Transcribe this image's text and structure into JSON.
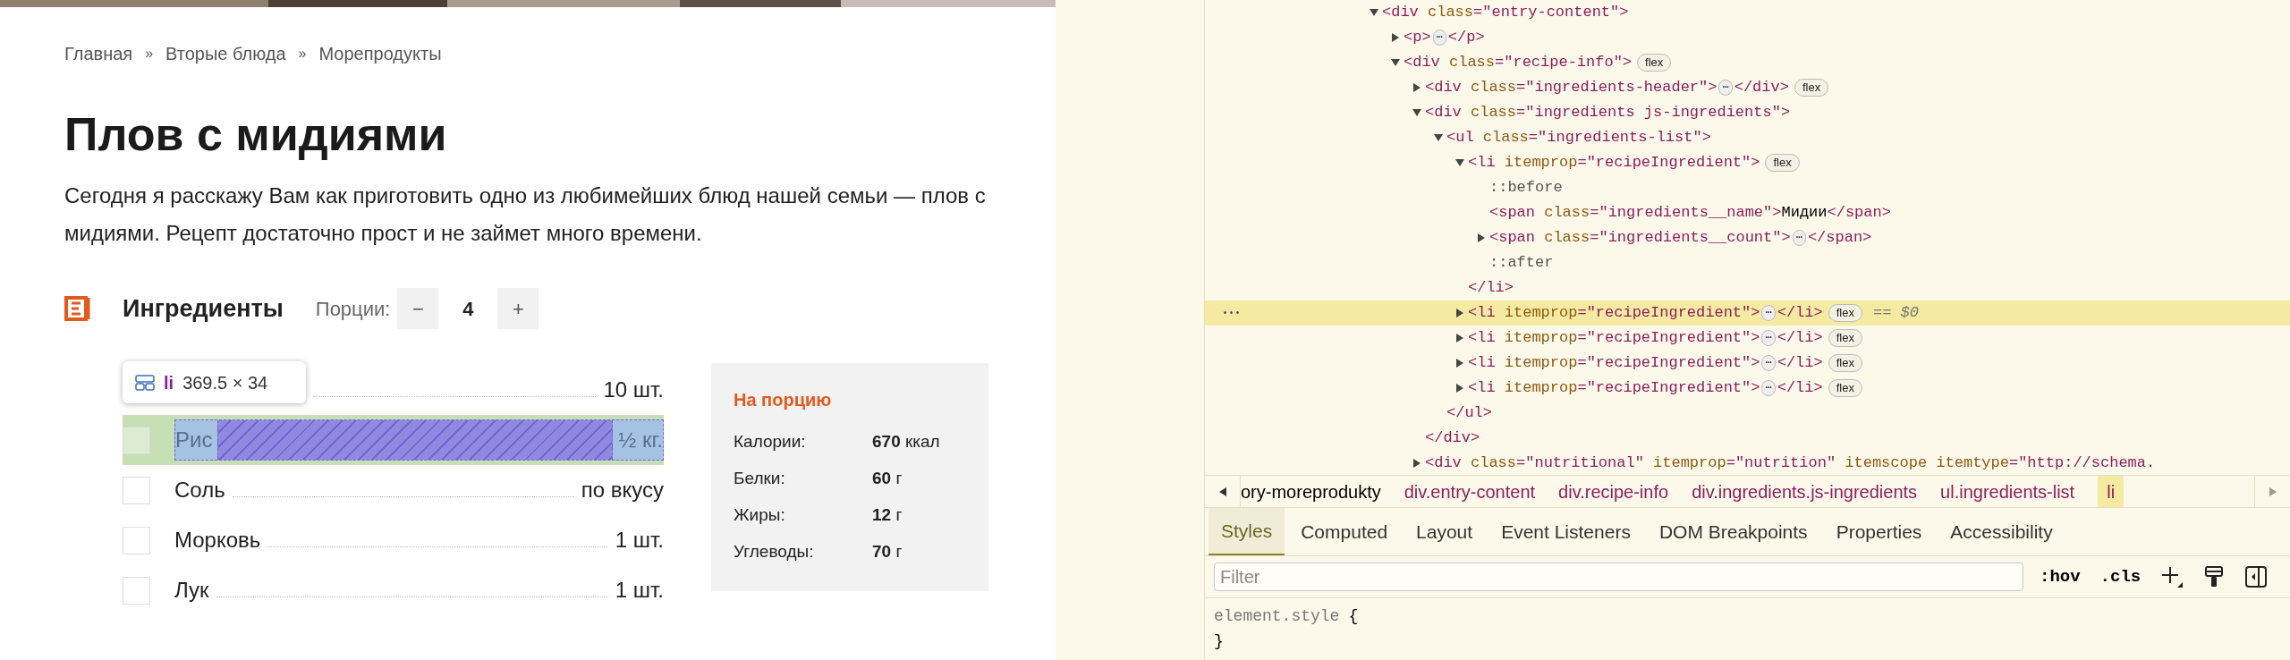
{
  "page": {
    "breadcrumb": [
      {
        "kind": "link",
        "text": "Главная"
      },
      {
        "kind": "separator",
        "text": "»"
      },
      {
        "kind": "link",
        "text": "Вторые блюда"
      },
      {
        "kind": "separator",
        "text": "»"
      },
      {
        "kind": "link",
        "text": "Морепродукты"
      }
    ],
    "title": "Плов с мидиями",
    "intro": "Сегодня я расскажу Вам как приготовить одно из любимейших блюд нашей семьи — плов с мидиями. Рецепт достаточно прост и не займет много времени.",
    "ingredients_header": {
      "title": "Ингредиенты",
      "servings_label": "Порции:",
      "minus": "−",
      "servings": "4",
      "plus": "+"
    },
    "inspector_tooltip": {
      "tag": "li",
      "size": "369.5 × 34"
    },
    "ingredients": [
      {
        "amount": "10 шт.",
        "highlighted": false
      },
      {
        "name": "Рис",
        "amount": "½ кг.",
        "checked": false,
        "highlighted": true
      },
      {
        "name": "Соль",
        "amount": "по вкусу",
        "checked": false,
        "highlighted": false
      },
      {
        "name": "Морковь",
        "amount": "1 шт.",
        "checked": false,
        "highlighted": false
      },
      {
        "name": "Лук",
        "amount": "1 шт.",
        "checked": false,
        "highlighted": false
      }
    ],
    "nutrition": {
      "title": "На порцию",
      "rows": [
        {
          "label": "Калории:",
          "value": "**670** ккал"
        },
        {
          "label": "Белки:",
          "value": "**60** г"
        },
        {
          "label": "Жиры:",
          "value": "**12** г"
        },
        {
          "label": "Углеводы:",
          "value": "**70** г"
        }
      ]
    }
  },
  "devtools": {
    "dom_tree": [
      {
        "selected": false,
        "expanded": true,
        "tokens": [
          {
            "kind": "tag",
            "text": "<div"
          },
          {
            "kind": "attr",
            "text": " class"
          },
          {
            "kind": "tag",
            "text": "=\"entry-content\">"
          }
        ],
        "children": [
          {
            "selected": false,
            "expanded": false,
            "tokens": [
              {
                "kind": "tag",
                "text": "<p>"
              },
              {
                "kind": "more",
                "text": "⋯"
              },
              {
                "kind": "tag",
                "text": "</p>"
              }
            ]
          },
          {
            "selected": false,
            "expanded": true,
            "badge": "flex",
            "tokens": [
              {
                "kind": "tag",
                "text": "<div"
              },
              {
                "kind": "attr",
                "text": " class"
              },
              {
                "kind": "tag",
                "text": "=\"recipe-info\">"
              }
            ],
            "children": [
              {
                "selected": false,
                "expanded": false,
                "badge": "flex",
                "tokens": [
                  {
                    "kind": "tag",
                    "text": "<div"
                  },
                  {
                    "kind": "attr",
                    "text": " class"
                  },
                  {
                    "kind": "tag",
                    "text": "=\"ingredients-header\">"
                  },
                  {
                    "kind": "more",
                    "text": "⋯"
                  },
                  {
                    "kind": "tag",
                    "text": "</div>"
                  }
                ]
              },
              {
                "selected": false,
                "expanded": true,
                "tokens": [
                  {
                    "kind": "tag",
                    "text": "<div"
                  },
                  {
                    "kind": "attr",
                    "text": " class"
                  },
                  {
                    "kind": "tag",
                    "text": "=\"ingredients js-ingredients\">"
                  }
                ],
                "close": [
                  {
                    "kind": "tag",
                    "text": "</div>"
                  }
                ],
                "children": [
                  {
                    "selected": false,
                    "expanded": true,
                    "tokens": [
                      {
                        "kind": "tag",
                        "text": "<ul"
                      },
                      {
                        "kind": "attr",
                        "text": " class"
                      },
                      {
                        "kind": "tag",
                        "text": "=\"ingredients-list\">"
                      }
                    ],
                    "close": [
                      {
                        "kind": "tag",
                        "text": "</ul>"
                      }
                    ],
                    "children": [
                      {
                        "selected": false,
                        "expanded": true,
                        "badge": "flex",
                        "tokens": [
                          {
                            "kind": "tag",
                            "text": "<li"
                          },
                          {
                            "kind": "attr",
                            "text": " itemprop"
                          },
                          {
                            "kind": "tag",
                            "text": "=\"recipeIngredient\">"
                          }
                        ],
                        "close": [
                          {
                            "kind": "tag",
                            "text": "</li>"
                          }
                        ],
                        "children": [
                          {
                            "selected": false,
                            "tokens": [
                              {
                                "kind": "pseudo",
                                "text": "::before"
                              }
                            ]
                          },
                          {
                            "selected": false,
                            "tokens": [
                              {
                                "kind": "tag",
                                "text": "<span"
                              },
                              {
                                "kind": "attr",
                                "text": " class"
                              },
                              {
                                "kind": "tag",
                                "text": "=\"ingredients__name\">"
                              },
                              {
                                "kind": "text",
                                "text": "Мидии"
                              },
                              {
                                "kind": "tag",
                                "text": "</span>"
                              }
                            ]
                          },
                          {
                            "selected": false,
                            "expanded": false,
                            "tokens": [
                              {
                                "kind": "tag",
                                "text": "<span"
                              },
                              {
                                "kind": "attr",
                                "text": " class"
                              },
                              {
                                "kind": "tag",
                                "text": "=\"ingredients__count\">"
                              },
                              {
                                "kind": "more",
                                "text": "⋯"
                              },
                              {
                                "kind": "tag",
                                "text": "</span>"
                              }
                            ]
                          },
                          {
                            "selected": false,
                            "tokens": [
                              {
                                "kind": "pseudo",
                                "text": "::after"
                              }
                            ]
                          }
                        ]
                      },
                      {
                        "selected": true,
                        "expanded": false,
                        "badge": "flex",
                        "gutter": "•••",
                        "marker": "== $0",
                        "tokens": [
                          {
                            "kind": "tag",
                            "text": "<li"
                          },
                          {
                            "kind": "attr",
                            "text": " itemprop"
                          },
                          {
                            "kind": "tag",
                            "text": "=\"recipeIngredient\">"
                          },
                          {
                            "kind": "more",
                            "text": "⋯"
                          },
                          {
                            "kind": "tag",
                            "text": "</li>"
                          }
                        ]
                      },
                      {
                        "selected": false,
                        "expanded": false,
                        "badge": "flex",
                        "tokens": [
                          {
                            "kind": "tag",
                            "text": "<li"
                          },
                          {
                            "kind": "attr",
                            "text": " itemprop"
                          },
                          {
                            "kind": "tag",
                            "text": "=\"recipeIngredient\">"
                          },
                          {
                            "kind": "more",
                            "text": "⋯"
                          },
                          {
                            "kind": "tag",
                            "text": "</li>"
                          }
                        ]
                      },
                      {
                        "selected": false,
                        "expanded": false,
                        "badge": "flex",
                        "tokens": [
                          {
                            "kind": "tag",
                            "text": "<li"
                          },
                          {
                            "kind": "attr",
                            "text": " itemprop"
                          },
                          {
                            "kind": "tag",
                            "text": "=\"recipeIngredient\">"
                          },
                          {
                            "kind": "more",
                            "text": "⋯"
                          },
                          {
                            "kind": "tag",
                            "text": "</li>"
                          }
                        ]
                      },
                      {
                        "selected": false,
                        "expanded": false,
                        "badge": "flex",
                        "tokens": [
                          {
                            "kind": "tag",
                            "text": "<li"
                          },
                          {
                            "kind": "attr",
                            "text": " itemprop"
                          },
                          {
                            "kind": "tag",
                            "text": "=\"recipeIngredient\">"
                          },
                          {
                            "kind": "more",
                            "text": "⋯"
                          },
                          {
                            "kind": "tag",
                            "text": "</li>"
                          }
                        ]
                      }
                    ]
                  }
                ]
              },
              {
                "selected": false,
                "expanded": false,
                "tokens": [
                  {
                    "kind": "tag",
                    "text": "<div"
                  },
                  {
                    "kind": "attr",
                    "text": " class"
                  },
                  {
                    "kind": "tag",
                    "text": "=\"nutritional\""
                  },
                  {
                    "kind": "attr",
                    "text": " itemprop"
                  },
                  {
                    "kind": "tag",
                    "text": "=\"nutrition\""
                  },
                  {
                    "kind": "attr",
                    "text": " itemscope"
                  },
                  {
                    "kind": "attr",
                    "text": " itemtype"
                  },
                  {
                    "kind": "tag",
                    "text": "=\"http://schema."
                  }
                ]
              }
            ]
          }
        ]
      }
    ],
    "breadcrumb": [
      {
        "kind": "plain",
        "text": "ory-moreprodukty",
        "selected": false
      },
      {
        "kind": "element",
        "text": "div.entry-content",
        "selected": false
      },
      {
        "kind": "element",
        "text": "div.recipe-info",
        "selected": false
      },
      {
        "kind": "element",
        "text": "div.ingredients.js-ingredients",
        "selected": false
      },
      {
        "kind": "element",
        "text": "ul.ingredients-list",
        "selected": false
      },
      {
        "kind": "element",
        "text": "li",
        "selected": true
      }
    ],
    "tabs": [
      {
        "label": "Styles",
        "selected": true
      },
      {
        "label": "Computed",
        "selected": false
      },
      {
        "label": "Layout",
        "selected": false
      },
      {
        "label": "Event Listeners",
        "selected": false
      },
      {
        "label": "DOM Breakpoints",
        "selected": false
      },
      {
        "label": "Properties",
        "selected": false
      },
      {
        "label": "Accessibility",
        "selected": false
      }
    ],
    "filter": {
      "placeholder": "Filter"
    },
    "filter_buttons": [
      ":hov",
      ".cls"
    ],
    "rule": {
      "selector": "element.style",
      "open": "{",
      "close": "}"
    }
  }
}
